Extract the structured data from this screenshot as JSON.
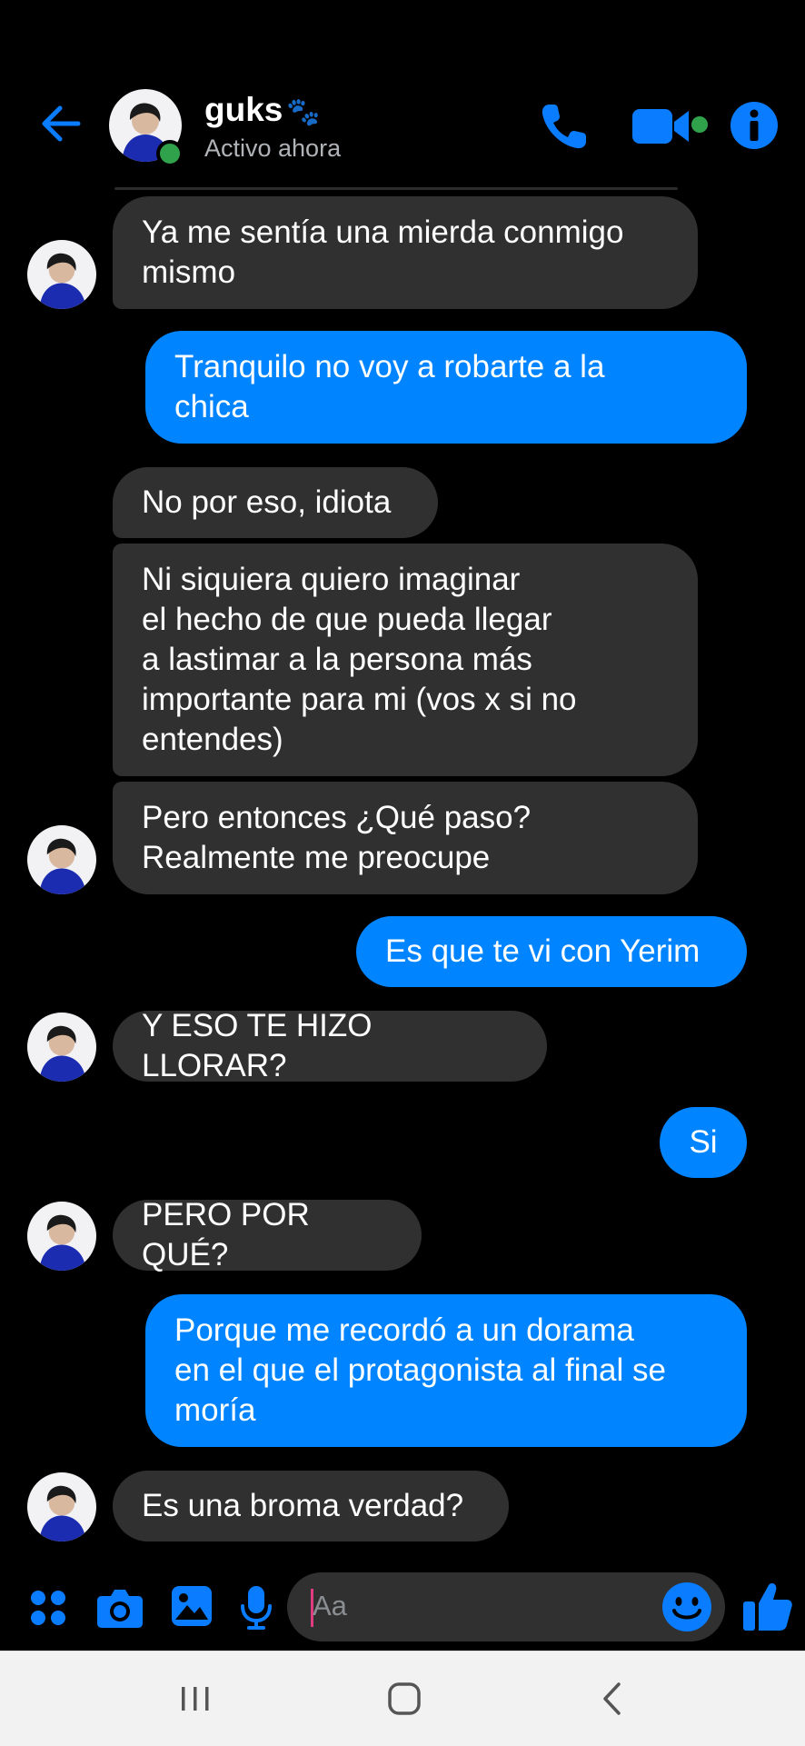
{
  "header": {
    "contact_name": "guks",
    "name_decoration": "🐾",
    "status": "Activo ahora",
    "icons": [
      "back-arrow-icon",
      "phone-icon",
      "video-camera-icon",
      "info-icon"
    ]
  },
  "messages": [
    {
      "sender": "them",
      "text": "Ya me sentía una mierda conmigo\nmismo"
    },
    {
      "sender": "me",
      "text": "Tranquilo no voy a robarte a la\nchica"
    },
    {
      "sender": "them",
      "text": "No por eso, idiota"
    },
    {
      "sender": "them",
      "text": "Ni siquiera quiero imaginar\nel hecho de que pueda llegar\na lastimar a la persona más\nimportante para mi (vos x si no\nentendes)"
    },
    {
      "sender": "them",
      "text": "Pero entonces ¿Qué paso?\nRealmente me preocupe"
    },
    {
      "sender": "me",
      "text": "Es que te vi con Yerim"
    },
    {
      "sender": "them",
      "text": "Y ESO TE HIZO LLORAR?"
    },
    {
      "sender": "me",
      "text": "Si"
    },
    {
      "sender": "them",
      "text": "PERO POR QUÉ?"
    },
    {
      "sender": "me",
      "text": "Porque me recordó a un dorama\nen el que el protagonista al final se\nmoría"
    },
    {
      "sender": "them",
      "text": "Es una broma verdad?"
    }
  ],
  "composer": {
    "placeholder": "Aa",
    "icons": [
      "menu-dots-icon",
      "camera-icon",
      "gallery-icon",
      "microphone-icon",
      "emoji-icon",
      "like-icon"
    ]
  },
  "navbar": {
    "icons": [
      "recents-icon",
      "home-icon",
      "back-icon"
    ]
  },
  "colors": {
    "accent": "#0084ff",
    "received_bubble": "#303030",
    "online": "#31a24c",
    "background": "#000000"
  }
}
